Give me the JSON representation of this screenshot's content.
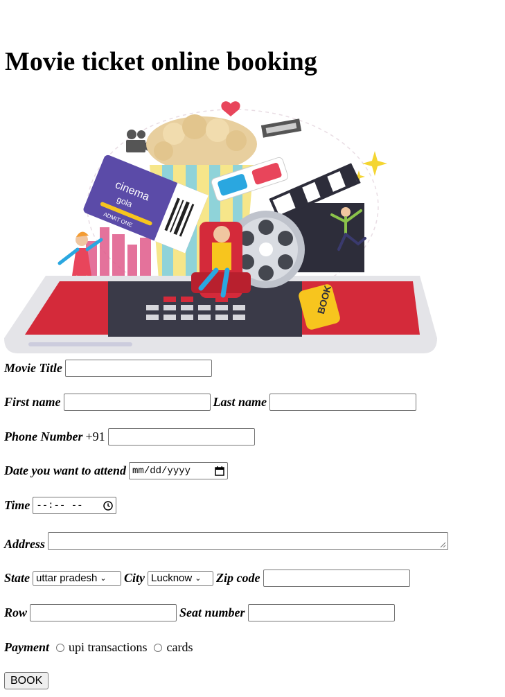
{
  "heading": "Movie ticket online booking",
  "hero": {
    "icon": "cinema-illustration",
    "ticket_brand_line1": "cinema",
    "ticket_brand_line2": "gola",
    "ticket_admit": "ADMIT ONE",
    "book_button_text": "BOOK"
  },
  "form": {
    "movie_title_label": "Movie Title",
    "movie_title_value": "",
    "first_name_label": "First name",
    "first_name_value": "",
    "last_name_label": "Last name",
    "last_name_value": "",
    "phone_label": "Phone Number",
    "phone_prefix": "+91",
    "phone_value": "",
    "date_label": "Date you want to attend",
    "date_placeholder": "mm/dd/yyyy",
    "time_label": "Time",
    "time_placeholder": "--:-- --",
    "address_label": "Address",
    "address_value": "",
    "state_label": "State",
    "state_selected": "uttar pradesh",
    "city_label": "City",
    "city_selected": "Lucknow",
    "zip_label": "Zip code",
    "zip_value": "",
    "row_label": "Row",
    "row_value": "",
    "seat_label": "Seat number",
    "seat_value": "",
    "payment_label": "Payment",
    "payment_options": [
      "upi transactions",
      "cards"
    ],
    "submit_label": "BOOK"
  },
  "colors": {
    "red": "#d42a3a",
    "yellow": "#f7c51e",
    "purple": "#5b4ba8",
    "dark": "#2d2d3a"
  }
}
